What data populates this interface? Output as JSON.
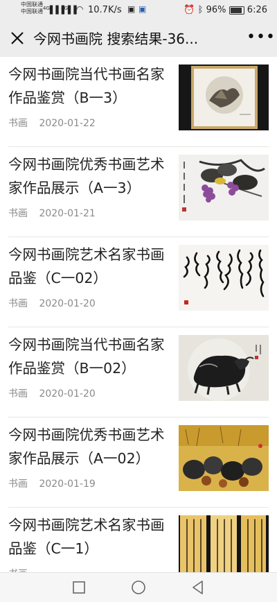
{
  "status_bar": {
    "carrier_1": "中国联通",
    "carrier_2": "中国联通",
    "network_1": "4G",
    "network_2": "4G",
    "net_speed": "10.7K/s",
    "battery": "96%",
    "time": "6:26"
  },
  "header": {
    "title": "今网书画院 搜索结果-36..."
  },
  "results": [
    {
      "title": "今网书画院当代书画名家作品鉴赏（B一3）",
      "category": "书画",
      "date": "2020-01-22",
      "image_icon": "framed-painting-image"
    },
    {
      "title": "今网书画院优秀书画艺术家作品展示（A一3）",
      "category": "书画",
      "date": "2020-01-21",
      "image_icon": "grapes-painting-image"
    },
    {
      "title": "今网书画院艺术名家书画品鉴（C一02）",
      "category": "书画",
      "date": "2020-01-20",
      "image_icon": "calligraphy-image"
    },
    {
      "title": "今网书画院当代书画名家作品鉴赏（B一02）",
      "category": "书画",
      "date": "2020-01-20",
      "image_icon": "yak-painting-image"
    },
    {
      "title": "今网书画院优秀书画艺术家作品展示（A一02）",
      "category": "书画",
      "date": "2020-01-19",
      "image_icon": "chicks-painting-image"
    },
    {
      "title": "今网书画院艺术名家书画品鉴（C一1）",
      "category": "书画",
      "date": "",
      "image_icon": "gold-calligraphy-image"
    }
  ],
  "nav": {
    "recents_icon": "square-icon",
    "home_icon": "circle-icon",
    "back_icon": "triangle-back-icon"
  },
  "colors": {
    "header_bg": "#ededed",
    "meta_text": "#8a8a8a",
    "divider": "#e6e6e6"
  }
}
